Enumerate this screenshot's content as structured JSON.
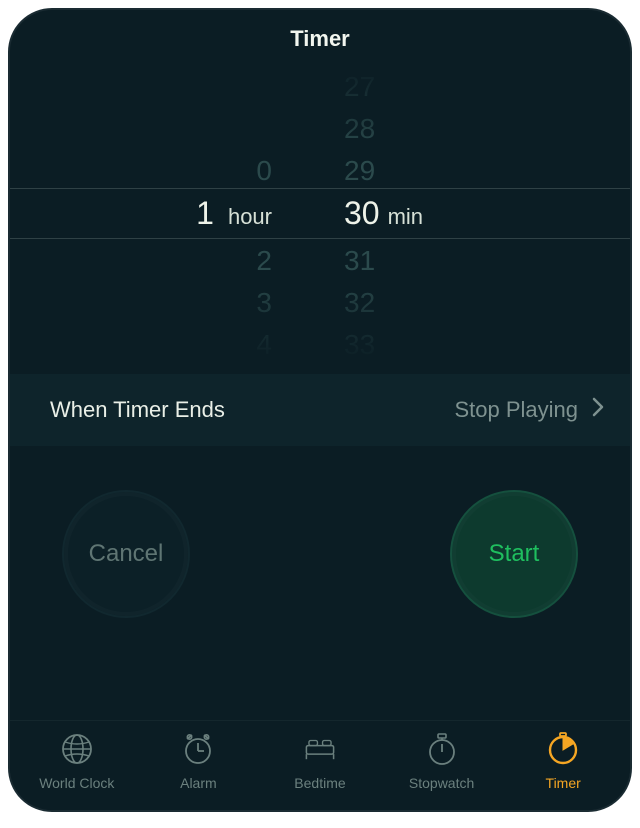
{
  "header": {
    "title": "Timer"
  },
  "picker": {
    "hours": {
      "visible_above": [
        "0"
      ],
      "selected": "1",
      "unit": "hour",
      "visible_below": [
        "2",
        "3",
        "4"
      ]
    },
    "minutes": {
      "visible_above": [
        "27",
        "28",
        "29"
      ],
      "selected": "30",
      "unit": "min",
      "visible_below": [
        "31",
        "32",
        "33"
      ]
    }
  },
  "option": {
    "label": "When Timer Ends",
    "value": "Stop Playing"
  },
  "buttons": {
    "cancel": "Cancel",
    "start": "Start"
  },
  "tabs": [
    {
      "id": "worldclock",
      "label": "World Clock",
      "active": false
    },
    {
      "id": "alarm",
      "label": "Alarm",
      "active": false
    },
    {
      "id": "bedtime",
      "label": "Bedtime",
      "active": false
    },
    {
      "id": "stopwatch",
      "label": "Stopwatch",
      "active": false
    },
    {
      "id": "timer",
      "label": "Timer",
      "active": true
    }
  ]
}
